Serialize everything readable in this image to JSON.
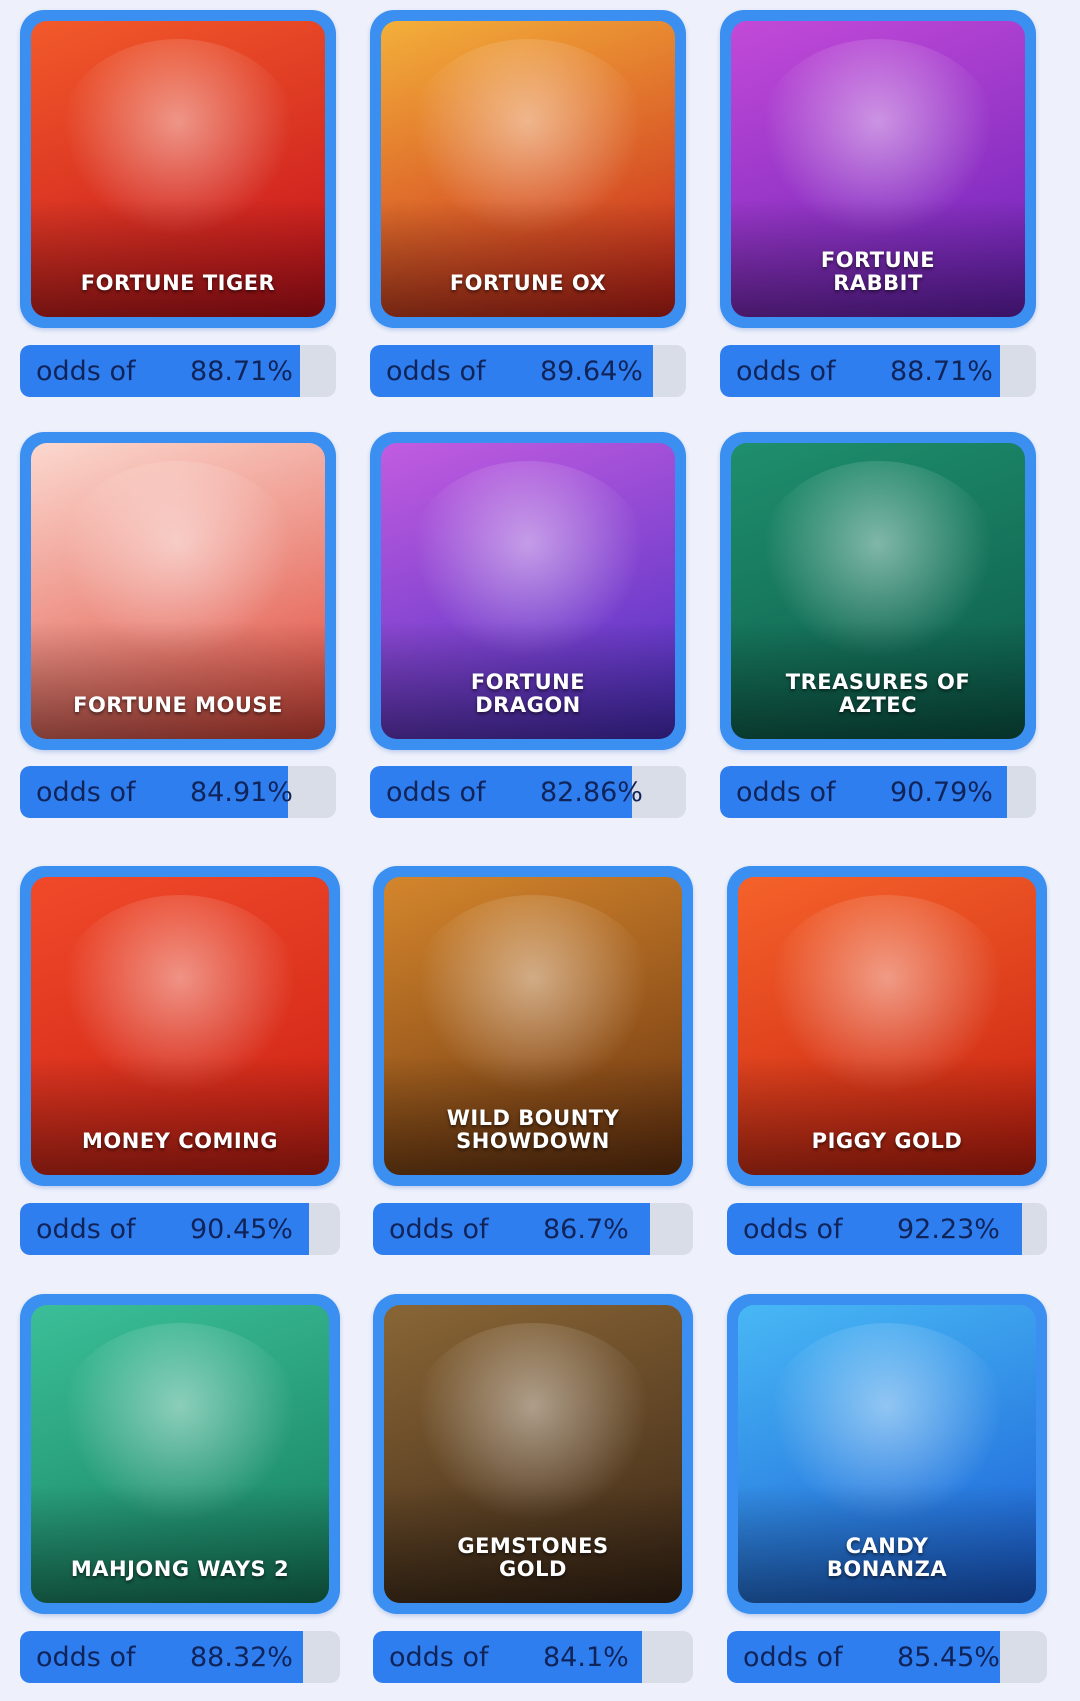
{
  "odds_label": "odds of",
  "games": [
    {
      "title": "FORTUNE TIGER",
      "odds_text": "88.71%",
      "odds": 88.71,
      "colors": [
        "#f25a2a",
        "#c4101c"
      ]
    },
    {
      "title": "FORTUNE OX",
      "odds_text": "89.64%",
      "odds": 89.64,
      "colors": [
        "#f3b03a",
        "#c8201a"
      ]
    },
    {
      "title": "FORTUNE\nRABBIT",
      "odds_text": "88.71%",
      "odds": 88.71,
      "colors": [
        "#c34ad8",
        "#6a22b8"
      ]
    },
    {
      "title": "FORTUNE MOUSE",
      "odds_text": "84.91%",
      "odds": 84.91,
      "colors": [
        "#fbd8cf",
        "#e0483a"
      ]
    },
    {
      "title": "FORTUNE\nDRAGON",
      "odds_text": "82.86%",
      "odds": 82.86,
      "colors": [
        "#c25ce0",
        "#4a2fc2"
      ]
    },
    {
      "title": "TREASURES OF\nAZTEC",
      "odds_text": "90.79%",
      "odds": 90.79,
      "colors": [
        "#1f8f6d",
        "#0c5a4a"
      ]
    },
    {
      "title": "MONEY COMING",
      "odds_text": "90.45%",
      "odds": 90.45,
      "colors": [
        "#f04a2a",
        "#cc1f14"
      ]
    },
    {
      "title": "WILD BOUNTY\nSHOWDOWN",
      "odds_text": "86.7%",
      "odds": 86.7,
      "colors": [
        "#d4862c",
        "#6a3410"
      ]
    },
    {
      "title": "PIGGY GOLD",
      "odds_text": "92.23%",
      "odds": 92.23,
      "colors": [
        "#f5622a",
        "#c81f10"
      ]
    },
    {
      "title": "MAHJONG WAYS 2",
      "odds_text": "88.32%",
      "odds": 88.32,
      "colors": [
        "#3bbf98",
        "#157d5c"
      ]
    },
    {
      "title": "GEMSTONES\nGOLD",
      "odds_text": "84.1%",
      "odds": 84.1,
      "colors": [
        "#8a6636",
        "#3a2616"
      ]
    },
    {
      "title": "CANDY\nBONANZA",
      "odds_text": "85.45%",
      "odds": 85.45,
      "colors": [
        "#48b8f5",
        "#1a5ed6"
      ]
    }
  ]
}
